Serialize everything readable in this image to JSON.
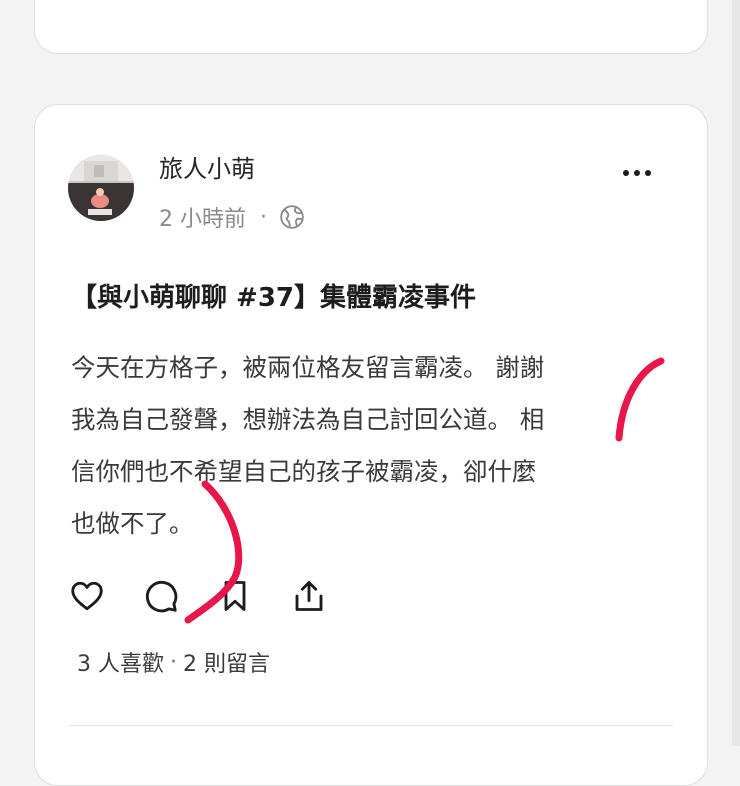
{
  "post": {
    "author": "旅人小萌",
    "time": "2 小時前",
    "meta_dot": "·",
    "title": "【與小萌聊聊 #37】集體霸凌事件",
    "body_lines": [
      "今天在方格子，被兩位格友留言霸凌。 謝謝",
      "我為自己發聲，想辦法為自己討回公道。 相",
      "信你們也不希望自己的孩子被霸凌，卻什麼",
      "也做不了。"
    ],
    "likes": "3 人喜歡",
    "stats_dot": "·",
    "comments": "2 則留言"
  },
  "icons": {
    "privacy": "globe-icon",
    "more": "more-dots-icon",
    "like": "heart-icon",
    "comment": "comment-bubble-icon",
    "bookmark": "bookmark-icon",
    "share": "share-icon"
  },
  "colors": {
    "annotation": "#e8174b",
    "background": "#f3f3f3",
    "card": "#ffffff"
  }
}
